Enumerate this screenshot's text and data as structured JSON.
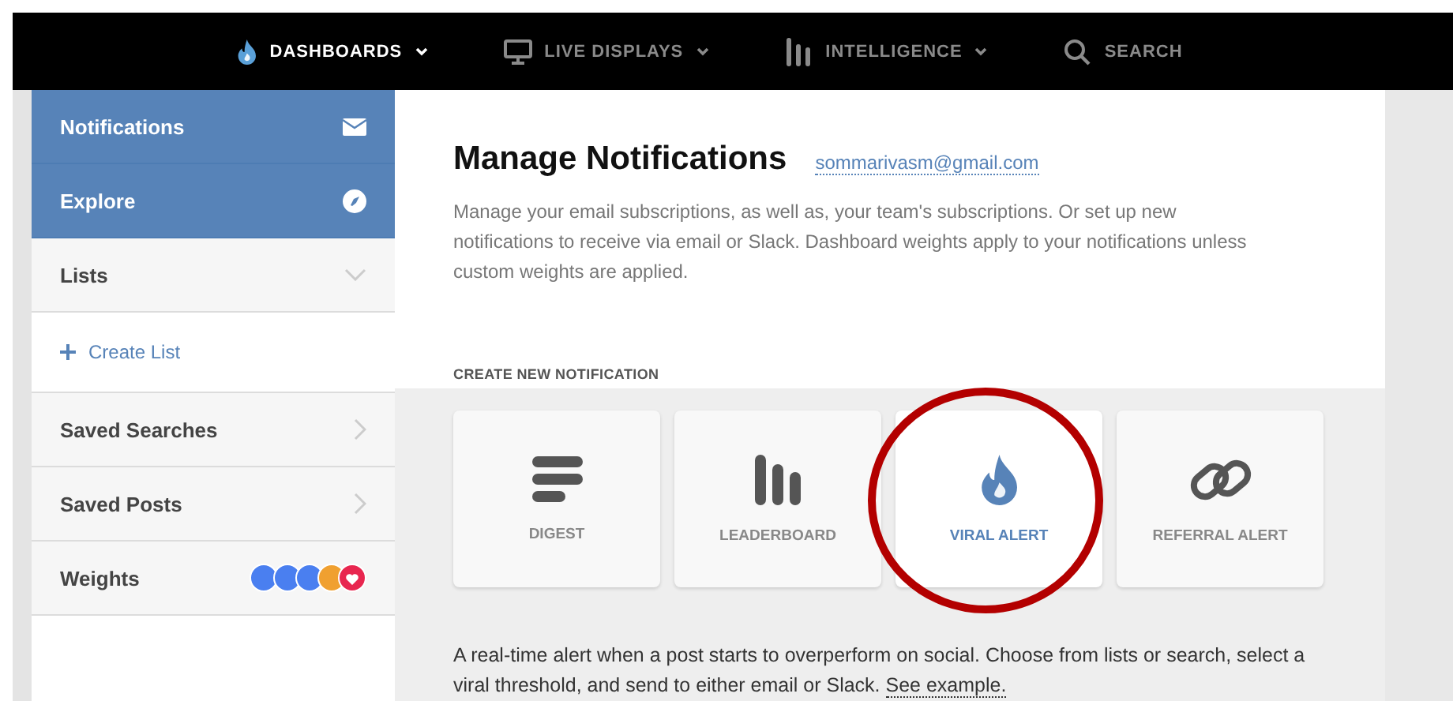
{
  "nav": [
    {
      "kind": "flame",
      "label": "DASHBOARDS",
      "selected": true,
      "dropdown": true
    },
    {
      "kind": "monitor",
      "label": "LIVE DISPLAYS",
      "selected": false,
      "dropdown": true
    },
    {
      "kind": "bars",
      "label": "INTELLIGENCE",
      "selected": false,
      "dropdown": true
    },
    {
      "kind": "search",
      "label": "SEARCH",
      "selected": false,
      "dropdown": false
    }
  ],
  "sidebar": {
    "items": [
      {
        "kind": "primary",
        "label": "Notifications"
      },
      {
        "kind": "primary",
        "label": "Explore"
      },
      {
        "kind": "section",
        "label": "Lists",
        "expanded": true
      },
      {
        "kind": "action",
        "label": "Create List"
      },
      {
        "kind": "section",
        "label": "Saved Searches",
        "expanded": false
      },
      {
        "kind": "section",
        "label": "Saved Posts",
        "expanded": false
      },
      {
        "kind": "weights",
        "label": "Weights"
      }
    ]
  },
  "header": {
    "title": "Manage Notifications",
    "email": "sommarivasm@gmail.com",
    "description": "Manage your email subscriptions, as well as, your team's subscriptions. Or set up new notifications to receive via email or Slack. Dashboard weights apply to your notifications unless custom weights are applied."
  },
  "create": {
    "heading": "CREATE NEW NOTIFICATION",
    "cards": [
      {
        "kind": "digest",
        "label": "DIGEST",
        "selected": false
      },
      {
        "kind": "leaderboard",
        "label": "LEADERBOARD",
        "selected": false
      },
      {
        "kind": "viral",
        "label": "VIRAL ALERT",
        "selected": true
      },
      {
        "kind": "referral",
        "label": "REFERRAL ALERT",
        "selected": false
      }
    ],
    "description": "A real-time alert when a post starts to overperform on social. Choose from lists or search, select a viral threshold, and send to either email or Slack.",
    "link": "See example."
  }
}
